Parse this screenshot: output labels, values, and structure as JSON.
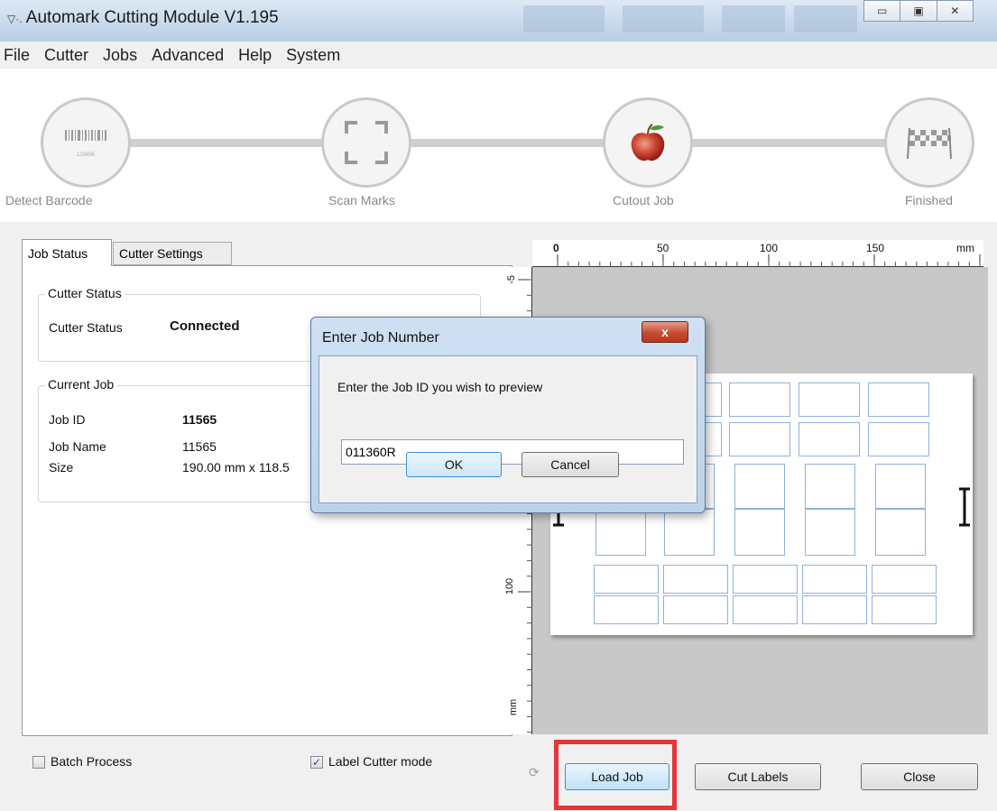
{
  "window": {
    "title": "Automark Cutting Module V1.195",
    "app_icon": "automark-icon",
    "controls": [
      "minimize-icon",
      "maximize-icon",
      "close-icon"
    ]
  },
  "menu": [
    "File",
    "Cutter",
    "Jobs",
    "Advanced",
    "Help",
    "System"
  ],
  "steps": [
    {
      "label": "Detect Barcode",
      "icon": "barcode-icon",
      "barcode_digits": "123456"
    },
    {
      "label": "Scan Marks",
      "icon": "scan-frame-icon"
    },
    {
      "label": "Cutout Job",
      "icon": "apple-icon"
    },
    {
      "label": "Finished",
      "icon": "checkered-flags-icon"
    }
  ],
  "tabs": [
    "Job Status",
    "Cutter Settings"
  ],
  "cutter_status": {
    "group": "Cutter Status",
    "label": "Cutter Status",
    "value": "Connected"
  },
  "current_job": {
    "group": "Current Job",
    "job_id_label": "Job ID",
    "job_id": "11565",
    "job_name_label": "Job Name",
    "job_name": "11565",
    "size_label": "Size",
    "size": "190.00 mm x 118.5"
  },
  "ruler": {
    "top_ticks": [
      "0",
      "50",
      "100",
      "150",
      "mm"
    ],
    "left_ticks": [
      "-5",
      "100",
      "mm"
    ]
  },
  "bottom": {
    "batch_process": {
      "label": "Batch Process",
      "checked": false
    },
    "label_cutter_mode": {
      "label": "Label Cutter mode",
      "checked": true
    },
    "refresh_icon": "refresh-icon",
    "load_job": "Load Job",
    "cut_labels": "Cut Labels",
    "close": "Close"
  },
  "dialog": {
    "title": "Enter Job Number",
    "close_glyph": "x",
    "prompt": "Enter the Job ID you wish to preview",
    "input_value": "011360R",
    "ok": "OK",
    "cancel": "Cancel"
  },
  "colors": {
    "highlight": "#e8353a",
    "label_outline": "#8fb1de",
    "load_job_accent": "#3c8fd8"
  }
}
